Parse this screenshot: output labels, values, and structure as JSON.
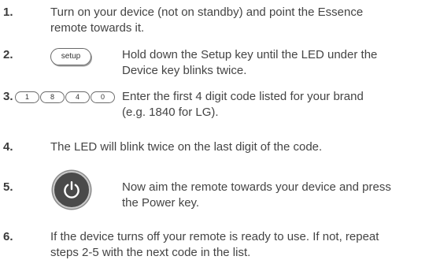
{
  "steps": [
    {
      "num": "1.",
      "text_line1": "Turn on your device (not on standby) and point the Essence",
      "text_line2": "remote towards it."
    },
    {
      "num": "2.",
      "key_label": "setup",
      "key_icon": "setup-key-icon",
      "text_line1": "Hold down the Setup key until the LED under the",
      "text_line2": "Device key blinks twice."
    },
    {
      "num": "3.",
      "digits": [
        "1",
        "8",
        "4",
        "0"
      ],
      "text_line1": "Enter the first 4 digit code listed for your brand",
      "text_line2": "(e.g. 1840 for LG)."
    },
    {
      "num": "4.",
      "text_line1": "The LED will blink twice on the last digit of the code."
    },
    {
      "num": "5.",
      "key_icon": "power-key-icon",
      "text_line1": "Now aim the remote towards your device and press",
      "text_line2": "the Power key."
    },
    {
      "num": "6.",
      "text_line1": "If the device turns off your remote is ready to use. If not, repeat",
      "text_line2": "steps 2-5 with the next code in the list."
    }
  ]
}
